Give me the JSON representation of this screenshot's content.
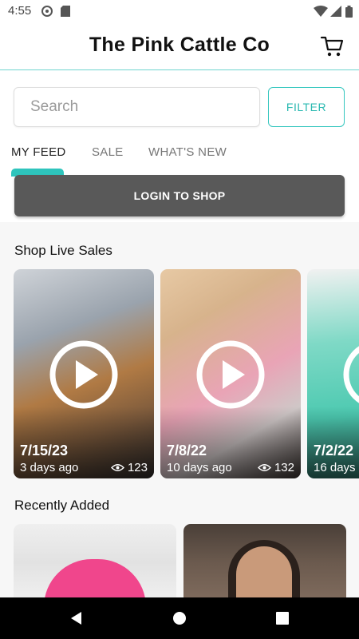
{
  "status_bar": {
    "time": "4:55"
  },
  "header": {
    "title": "The Pink Cattle Co"
  },
  "search": {
    "placeholder": "Search",
    "value": ""
  },
  "filter": {
    "label": "FILTER"
  },
  "tabs": [
    {
      "label": "MY FEED",
      "active": true
    },
    {
      "label": "SALE",
      "active": false
    },
    {
      "label": "WHAT'S NEW",
      "active": false
    }
  ],
  "login": {
    "label": "LOGIN TO SHOP"
  },
  "live_sales": {
    "title": "Shop Live Sales",
    "items": [
      {
        "date": "7/15/23",
        "ago": "3 days ago",
        "views": "123"
      },
      {
        "date": "7/8/22",
        "ago": "10 days ago",
        "views": "132"
      },
      {
        "date": "7/2/22",
        "ago": "16 days",
        "views": ""
      }
    ]
  },
  "recently_added": {
    "title": "Recently Added"
  },
  "colors": {
    "accent": "#2ec4bc",
    "login_bg": "#595959",
    "nav_bg": "#000000"
  },
  "icons": [
    "signal-icon",
    "wifi-icon",
    "battery-icon",
    "cart-icon",
    "play-icon",
    "eye-icon",
    "back-icon",
    "home-icon",
    "recents-icon"
  ]
}
